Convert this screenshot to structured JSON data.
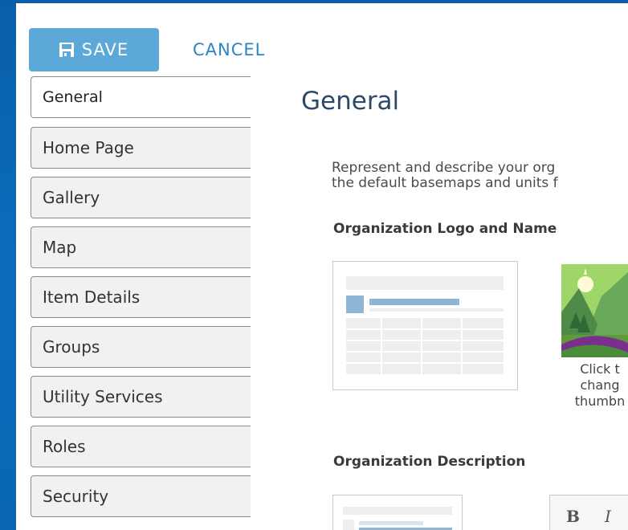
{
  "toolbar": {
    "save_label": "SAVE",
    "cancel_label": "CANCEL",
    "save_icon": "floppy-disk-icon",
    "accent_color": "#5ca8d8"
  },
  "sidebar": {
    "items": [
      {
        "label": "General",
        "active": true
      },
      {
        "label": "Home Page"
      },
      {
        "label": "Gallery"
      },
      {
        "label": "Map"
      },
      {
        "label": "Item Details"
      },
      {
        "label": "Groups"
      },
      {
        "label": "Utility Services"
      },
      {
        "label": "Roles"
      },
      {
        "label": "Security"
      }
    ]
  },
  "main": {
    "title": "General",
    "description_line1": "Represent and describe your org",
    "description_line2": "the default basemaps and units f",
    "logo_section_heading": "Organization Logo and Name",
    "thumbnail_caption": "Click t\nchang\nthumbn",
    "description_section_heading": "Organization Description",
    "editor": {
      "bold_label": "B",
      "italic_label": "I"
    }
  }
}
